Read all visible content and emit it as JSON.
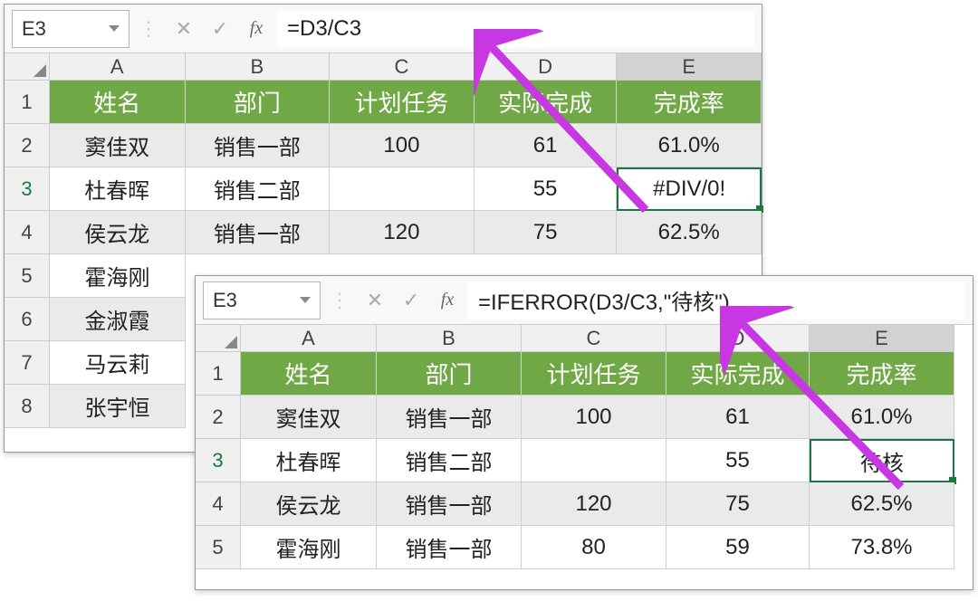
{
  "window1": {
    "name_box": "E3",
    "formula": "=D3/C3",
    "columns": [
      "A",
      "B",
      "C",
      "D",
      "E"
    ],
    "header_row": {
      "name": "姓名",
      "dept": "部门",
      "plan": "计划任务",
      "actual": "实际完成",
      "rate": "完成率"
    },
    "rows": [
      {
        "num": "2",
        "a": "窦佳双",
        "b": "销售一部",
        "c": "100",
        "d": "61",
        "e": "61.0%"
      },
      {
        "num": "3",
        "a": "杜春晖",
        "b": "销售二部",
        "c": "",
        "d": "55",
        "e": "#DIV/0!"
      },
      {
        "num": "4",
        "a": "侯云龙",
        "b": "销售一部",
        "c": "120",
        "d": "75",
        "e": "62.5%"
      },
      {
        "num": "5",
        "a": "霍海刚",
        "b": "",
        "c": "",
        "d": "",
        "e": ""
      },
      {
        "num": "6",
        "a": "金淑霞",
        "b": "",
        "c": "",
        "d": "",
        "e": ""
      },
      {
        "num": "7",
        "a": "马云莉",
        "b": "",
        "c": "",
        "d": "",
        "e": ""
      },
      {
        "num": "8",
        "a": "张宇恒",
        "b": "",
        "c": "",
        "d": "",
        "e": ""
      }
    ]
  },
  "window2": {
    "name_box": "E3",
    "formula": "=IFERROR(D3/C3,\"待核\")",
    "columns": [
      "A",
      "B",
      "C",
      "D",
      "E"
    ],
    "header_row": {
      "name": "姓名",
      "dept": "部门",
      "plan": "计划任务",
      "actual": "实际完成",
      "rate": "完成率"
    },
    "rows": [
      {
        "num": "2",
        "a": "窦佳双",
        "b": "销售一部",
        "c": "100",
        "d": "61",
        "e": "61.0%"
      },
      {
        "num": "3",
        "a": "杜春晖",
        "b": "销售二部",
        "c": "",
        "d": "55",
        "e": "待核"
      },
      {
        "num": "4",
        "a": "侯云龙",
        "b": "销售一部",
        "c": "120",
        "d": "75",
        "e": "62.5%"
      },
      {
        "num": "5",
        "a": "霍海刚",
        "b": "销售一部",
        "c": "80",
        "d": "59",
        "e": "73.8%"
      }
    ]
  },
  "icons": {
    "cancel": "✕",
    "enter": "✓",
    "fx": "fx",
    "sep": "⋮"
  }
}
